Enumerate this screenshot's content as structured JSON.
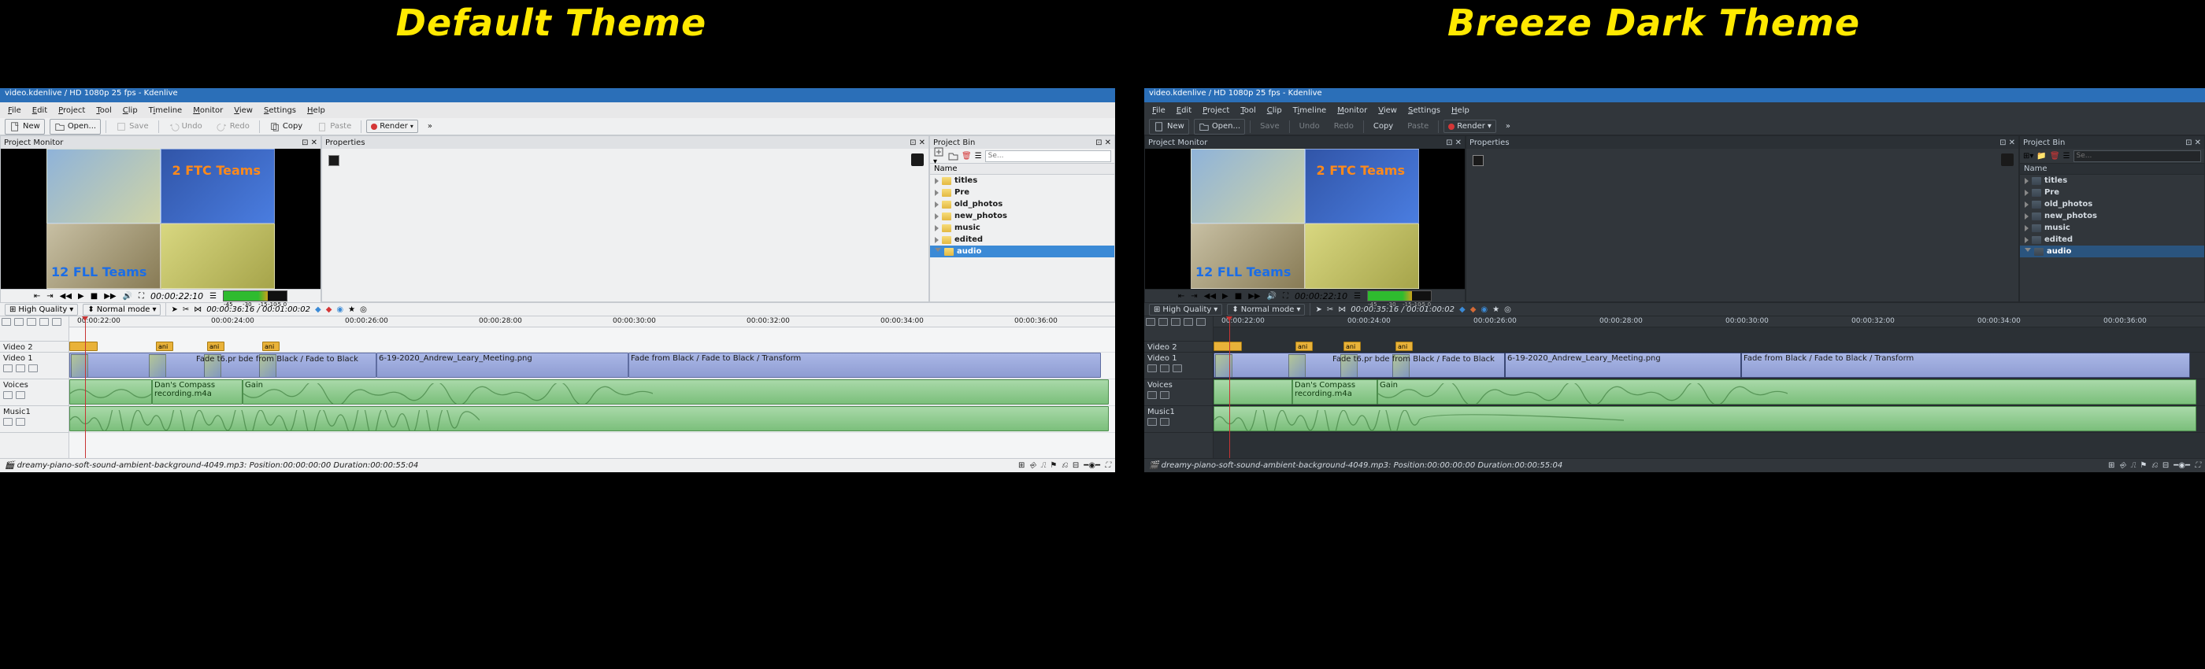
{
  "headings": {
    "left": "Default Theme",
    "right": "Breeze Dark Theme"
  },
  "titlebar": "video.kdenlive / HD 1080p 25 fps - Kdenlive",
  "menus": [
    "File",
    "Edit",
    "Project",
    "Tool",
    "Clip",
    "Timeline",
    "Monitor",
    "View",
    "Settings",
    "Help"
  ],
  "toolbar": {
    "new": "New",
    "open": "Open...",
    "save": "Save",
    "undo": "Undo",
    "redo": "Redo",
    "copy": "Copy",
    "paste": "Paste",
    "render": "Render"
  },
  "panels": {
    "projectMonitor": "Project Monitor",
    "properties": "Properties",
    "projectBin": "Project Bin"
  },
  "overlay": {
    "ftc": "2 FTC Teams",
    "fll": "12 FLL Teams"
  },
  "timecode": "00:00:22:10",
  "audiometer_labels": [
    "-45",
    "-30",
    "-15",
    "-10",
    "-5",
    "0"
  ],
  "bin": {
    "search_placeholder": "Se...",
    "header": "Name",
    "items": [
      "titles",
      "Pre",
      "old_photos",
      "new_photos",
      "music",
      "edited",
      "audio"
    ],
    "selected_index": 6
  },
  "tlhead": {
    "quality": "High Quality",
    "mode": "Normal mode",
    "tc_light": "00:00:36:16 / 00:01:00:02",
    "tc_dark": "00:00:35:16 / 00:01:00:02"
  },
  "ruler_labels": [
    "00:00:22:00",
    "00:00:24:00",
    "00:00:26:00",
    "00:00:28:00",
    "00:00:30:00",
    "00:00:32:00",
    "00:00:34:00",
    "00:00:36:00"
  ],
  "tracks": {
    "v2": "Video 2",
    "v1": "Video 1",
    "voices": "Voices",
    "music": "Music1"
  },
  "clip_labels": {
    "ani": "ani",
    "fade_run": "Fade t6.pr   bde from Black / Fade to Black",
    "title_long": "6-19-2020_Andrew_Leary_Meeting.png",
    "fade2": "Fade from Black / Fade to Black / Transform",
    "dan": "Dan's Compass recording.m4a",
    "gain": "Gain"
  },
  "status": "dreamy-piano-soft-sound-ambient-background-4049.mp3: Position:00:00:00:00 Duration:00:00:55:04",
  "colors": {
    "light_accent": "#3b8ad6",
    "dark_accent": "#2a547e"
  }
}
